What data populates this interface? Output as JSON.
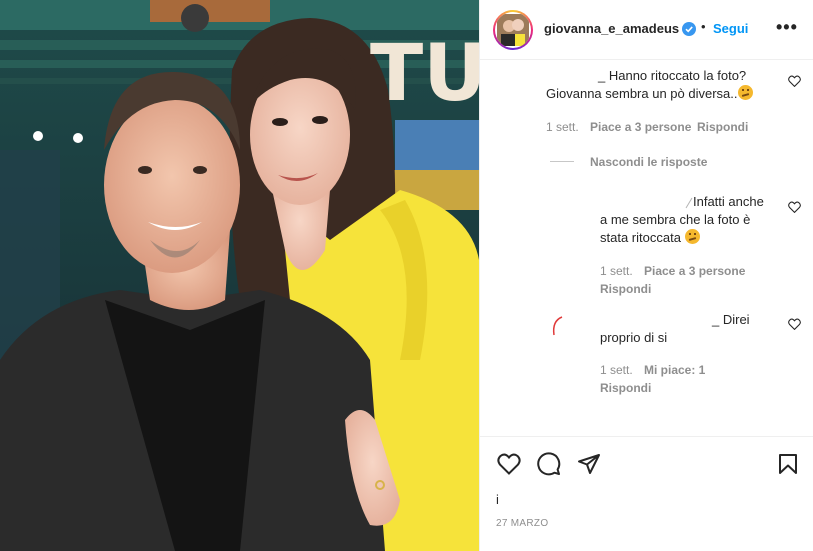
{
  "header": {
    "username": "giovanna_e_amadeus",
    "separator": "•",
    "follow_label": "Segui",
    "more_label": "•••"
  },
  "photo": {
    "backdrop_text": "TUC"
  },
  "comments": [
    {
      "text_line1": "_ Hanno ritoccato la foto?",
      "text_line2": "Giovanna sembra un pò diversa..",
      "time": "1 sett.",
      "likes": "Piace a 3 persone",
      "reply": "Rispondi"
    }
  ],
  "hide_replies": "Nascondi le risposte",
  "replies": [
    {
      "text_line1": "Infatti anche",
      "text_line2": "a me sembra che la foto è",
      "text_line3": "stata ritoccata",
      "time": "1 sett.",
      "likes": "Piace a 3 persone",
      "reply": "Rispondi"
    },
    {
      "text_line1": "_ Direi",
      "text_line2": "proprio di si",
      "time": "1 sett.",
      "likes": "Mi piace: 1",
      "reply": "Rispondi"
    }
  ],
  "actions": {
    "icons": [
      "heart-icon",
      "comment-icon",
      "share-icon",
      "bookmark-icon"
    ]
  },
  "likes_line": "i",
  "post_date": "27 MARZO",
  "colors": {
    "follow": "#0095f6",
    "verified": "#3897f0",
    "jacket_yellow": "#f6e33a",
    "secondary_text": "#8e8e8e"
  }
}
